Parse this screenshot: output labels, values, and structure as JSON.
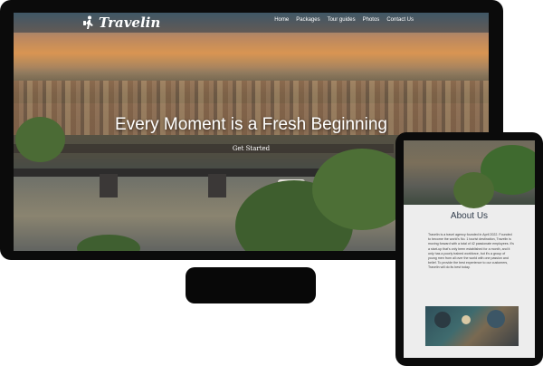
{
  "site": {
    "brand": "Travelin",
    "nav": [
      "Home",
      "Packages",
      "Tour guides",
      "Photos",
      "Contact Us"
    ],
    "hero_title": "Every Moment is a Fresh Beginning",
    "hero_cta": "Get Started",
    "icons": {
      "logo": "traveler-icon"
    }
  },
  "tablet": {
    "about_heading": "About Us",
    "about_text": "Travelin is a travel agency founded in April 2022. Founded to become the world's No. 1 tourist destination, Travelin is moving forward with a total of 42 passionate employees. It's a start-up that's only been established for a month, and it only has a poorly trained workforce, but it's a group of young men from all over the world with one passion and belief. To provide the best experience to our customers, Travelin will do its best today."
  },
  "colors": {
    "screen_frame": "#0b0b0b",
    "about_heading": "#2f3b4a",
    "nav_text": "#ffffff"
  }
}
